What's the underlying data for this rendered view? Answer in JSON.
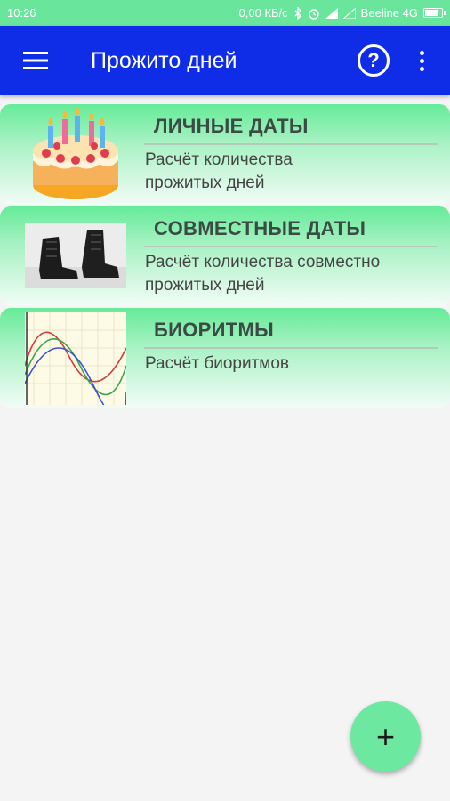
{
  "status_bar": {
    "time": "10:26",
    "network_speed": "0,00 КБ/с",
    "carrier": "Beeline 4G"
  },
  "app_bar": {
    "title": "Прожито дней",
    "menu_icon": "hamburger-menu-icon",
    "help_icon": "help-circle-icon",
    "help_glyph": "?",
    "more_icon": "more-vert-icon",
    "color": "#0f2de6"
  },
  "cards": [
    {
      "title": "ЛИЧНЫЕ ДАТЫ",
      "description": "Расчёт количества прожитых дней",
      "icon": "birthday-cake-icon"
    },
    {
      "title": "СОВМЕСТНЫЕ ДАТЫ",
      "description": "Расчёт количества совместно прожитых дней",
      "icon": "boots-photo"
    },
    {
      "title": "БИОРИТМЫ",
      "description": "Расчёт биоритмов",
      "icon": "biorhythm-chart-icon"
    }
  ],
  "fab": {
    "label": "+",
    "icon": "add-icon",
    "color": "#6ce8a0"
  },
  "colors": {
    "status_bar": "#69e59c",
    "card_top": "#65eb98"
  }
}
